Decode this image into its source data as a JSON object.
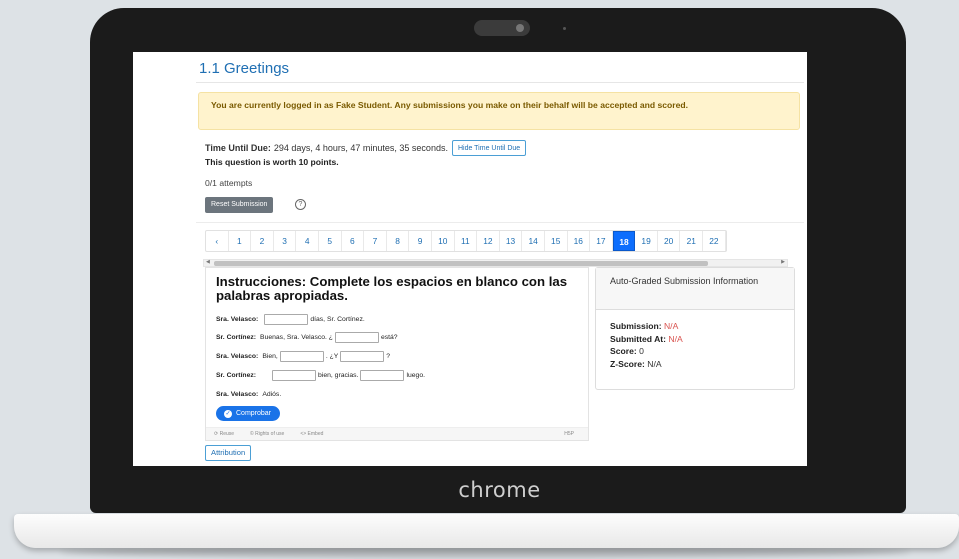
{
  "device": {
    "brand_logo": "chrome"
  },
  "page": {
    "title": "1.1 Greetings",
    "alert": "You are currently logged in as Fake Student. Any submissions you make on their behalf will be accepted and scored.",
    "due": {
      "label": "Time Until Due:",
      "value": "294 days, 4 hours, 47 minutes, 35 seconds.",
      "hide_button": "Hide Time Until Due"
    },
    "worth": "This question is worth 10 points.",
    "attempts": "0/1 attempts",
    "reset_button": "Reset Submission",
    "help_icon": "?",
    "pagination": {
      "prev": "‹",
      "pages": [
        "1",
        "2",
        "3",
        "4",
        "5",
        "6",
        "7",
        "8",
        "9",
        "10",
        "11",
        "12",
        "13",
        "14",
        "15",
        "16",
        "17",
        "18",
        "19",
        "20",
        "21",
        "22"
      ],
      "active": "18"
    },
    "attribution_button": "Attribution"
  },
  "exercise": {
    "title": "Instrucciones: Complete los espacios en blanco con las palabras apropiadas.",
    "lines": [
      {
        "speaker": "Sra. Velasco:",
        "parts": [
          "",
          "días, Sr. Cortínez."
        ]
      },
      {
        "speaker": "Sr. Cortínez:",
        "parts": [
          "Buenas, Sra. Velasco. ¿",
          "está?"
        ]
      },
      {
        "speaker": "Sra. Velasco:",
        "parts": [
          "Bien,",
          ". ¿Y",
          "?"
        ]
      },
      {
        "speaker": "Sr. Cortínez:",
        "parts": [
          "",
          "bien, gracias.",
          "luego."
        ]
      },
      {
        "speaker": "Sra. Velasco:",
        "parts": [
          "Adiós."
        ]
      }
    ],
    "check_button": "Comprobar",
    "footer": {
      "reuse": "Reuse",
      "rights": "Rights of use",
      "embed": "Embed",
      "h5p": "H5P"
    }
  },
  "submission_card": {
    "heading": "Auto-Graded Submission Information",
    "submission_label": "Submission:",
    "submission_value": "N/A",
    "submitted_at_label": "Submitted At:",
    "submitted_at_value": "N/A",
    "score_label": "Score:",
    "score_value": "0",
    "zscore_label": "Z-Score:",
    "zscore_value": "N/A"
  },
  "colors": {
    "accent": "#1f6fb3",
    "active_page": "#0d6efd",
    "alert_bg": "#fff3cd",
    "na": "#d9534f"
  }
}
